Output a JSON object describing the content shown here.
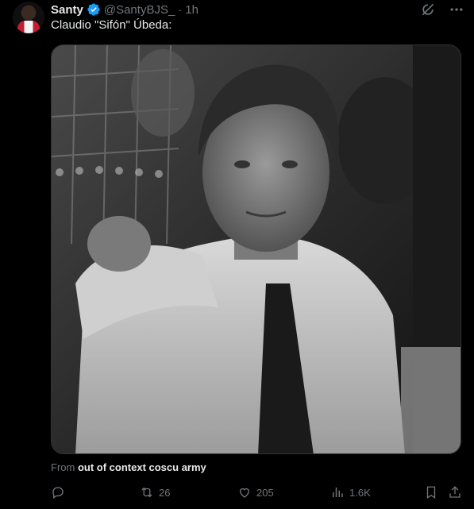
{
  "tweet": {
    "author_name": "Santy",
    "handle": "@SantyBJS_",
    "separator": "·",
    "time": "1h",
    "text": "Claudio \"Sifón\" Úbeda:",
    "from_prefix": "From",
    "from_source": "out of context coscu army"
  },
  "actions": {
    "replies": "",
    "retweets": "26",
    "likes": "205",
    "views": "1.6K"
  },
  "icons": {
    "verified": "verified-badge-icon",
    "grok": "grok-icon",
    "more": "more-icon",
    "reply": "reply-icon",
    "retweet": "retweet-icon",
    "like": "heart-icon",
    "views": "views-icon",
    "bookmark": "bookmark-icon",
    "share": "share-icon"
  },
  "colors": {
    "background": "#000000",
    "text": "#e7e9ea",
    "muted": "#71767b",
    "verified": "#1d9bf0"
  }
}
